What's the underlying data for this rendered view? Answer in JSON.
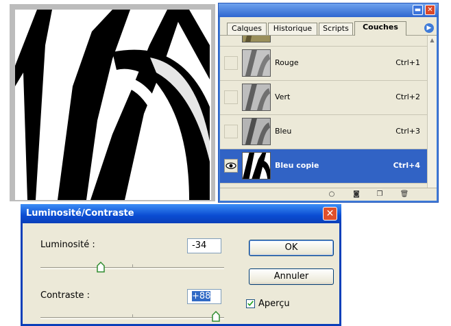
{
  "panel": {
    "tabs": [
      {
        "label": "Calques"
      },
      {
        "label": "Historique"
      },
      {
        "label": "Scripts"
      },
      {
        "label": "Couches"
      }
    ],
    "channels": [
      {
        "name": "Rouge",
        "shortcut": "Ctrl+1",
        "visible": false,
        "selected": false
      },
      {
        "name": "Vert",
        "shortcut": "Ctrl+2",
        "visible": false,
        "selected": false
      },
      {
        "name": "Bleu",
        "shortcut": "Ctrl+3",
        "visible": false,
        "selected": false
      },
      {
        "name": "Bleu copie",
        "shortcut": "Ctrl+4",
        "visible": true,
        "selected": true
      }
    ],
    "footer_icons": [
      "load-selection-icon",
      "save-selection-icon",
      "new-channel-icon",
      "trash-icon"
    ]
  },
  "dialog": {
    "title": "Luminosité/Contraste",
    "brightness": {
      "label": "Luminosité :",
      "value": "-34"
    },
    "contrast": {
      "label": "Contraste :",
      "value": "+88"
    },
    "ok_label": "OK",
    "cancel_label": "Annuler",
    "preview": {
      "label": "Aperçu",
      "checked": true
    }
  },
  "colors": {
    "xp_blue": "#0a3fb9",
    "selection": "#3163c5",
    "panel_bg": "#ece9d8",
    "close_red": "#e0502c"
  }
}
